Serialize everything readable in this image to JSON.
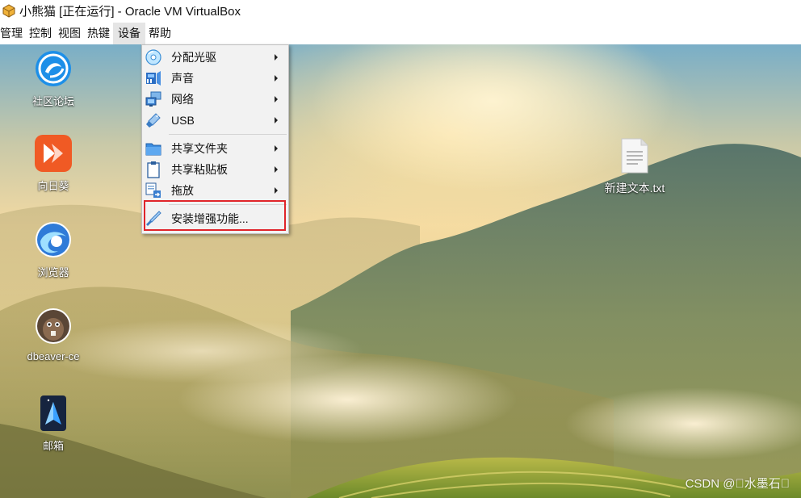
{
  "window": {
    "title": "小熊猫 [正在运行] - Oracle VM VirtualBox",
    "icon": "virtualbox-icon"
  },
  "menubar": {
    "items": [
      {
        "label": "管理"
      },
      {
        "label": "控制"
      },
      {
        "label": "视图"
      },
      {
        "label": "热键"
      },
      {
        "label": "设备",
        "active": true
      },
      {
        "label": "帮助"
      }
    ]
  },
  "devices_menu": {
    "items": [
      {
        "label": "分配光驱",
        "icon": "optical-disc-icon",
        "submenu": true
      },
      {
        "label": "声音",
        "icon": "audio-icon",
        "submenu": true
      },
      {
        "label": "网络",
        "icon": "network-icon",
        "submenu": true
      },
      {
        "label": "USB",
        "icon": "usb-icon",
        "submenu": true
      },
      {
        "label": "共享文件夹",
        "icon": "shared-folder-icon",
        "submenu": true
      },
      {
        "label": "共享粘贴板",
        "icon": "clipboard-icon",
        "submenu": true
      },
      {
        "label": "拖放",
        "icon": "drag-drop-icon",
        "submenu": true
      },
      {
        "label": "安装增强功能...",
        "icon": "install-additions-icon",
        "submenu": false,
        "highlighted": true
      }
    ]
  },
  "desktop": {
    "icons": [
      {
        "label": "社区论坛",
        "icon": "deepin-forum-icon"
      },
      {
        "label": "向日葵",
        "icon": "sunlogin-icon"
      },
      {
        "label": "浏览器",
        "icon": "browser-icon"
      },
      {
        "label": "dbeaver-ce",
        "icon": "dbeaver-icon"
      },
      {
        "label": "邮箱",
        "icon": "mail-icon"
      },
      {
        "label": "新建文本.txt",
        "icon": "text-file-icon"
      }
    ],
    "watermark": "CSDN @\u0000水墨石\u0000"
  },
  "colors": {
    "highlight_border": "#e0242a",
    "menu_background": "#f2f2f2"
  }
}
